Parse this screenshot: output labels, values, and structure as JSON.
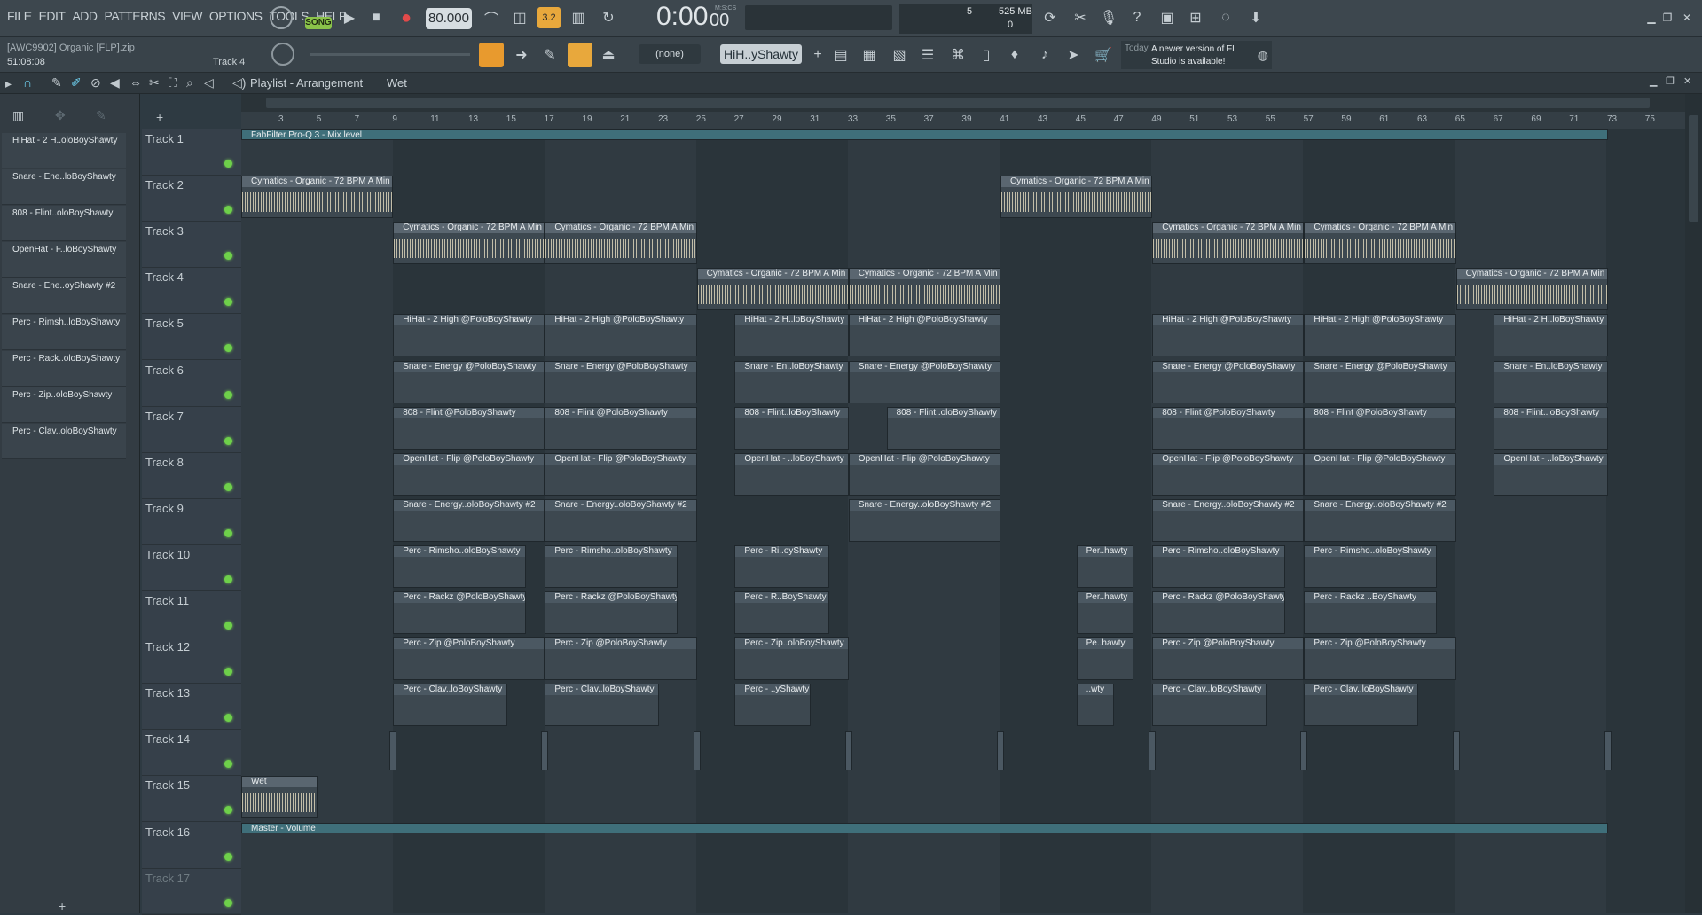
{
  "menu": {
    "items": [
      "FILE",
      "EDIT",
      "ADD",
      "PATTERNS",
      "VIEW",
      "OPTIONS",
      "TOOLS",
      "HELP"
    ]
  },
  "transport": {
    "mode": "SONG",
    "tempo": "80.000",
    "pattern_length": "3.2",
    "time": "0:00",
    "time_sub": "00",
    "time_unit": "M:S:CS"
  },
  "monitor": {
    "cpu_value": "5",
    "memory": "525 MB",
    "polyphony": "0"
  },
  "project": {
    "file": "[AWC9902] Organic [FLP].zip",
    "length": "51:08:08",
    "track_hint": "Track 4"
  },
  "snap": {
    "value": "(none)"
  },
  "pattern_selector": {
    "value": "HiH..yShawty"
  },
  "news": {
    "date": "Today",
    "message": "A newer version of FL Studio is available!"
  },
  "playlist": {
    "title": "Playlist - Arrangement",
    "crumb": "Wet"
  },
  "ruler": {
    "bars": [
      "3",
      "5",
      "7",
      "9",
      "11",
      "13",
      "15",
      "17",
      "19",
      "21",
      "23",
      "25",
      "27",
      "29",
      "31",
      "33",
      "35",
      "37",
      "39",
      "41",
      "43",
      "45",
      "47",
      "49",
      "51",
      "53",
      "55",
      "57",
      "59",
      "61",
      "63",
      "65",
      "67",
      "69",
      "71",
      "73",
      "75"
    ]
  },
  "picker": {
    "items": [
      "HiHat - 2 H..oloBoyShawty",
      "Snare - Ene..loBoyShawty",
      "808 - Flint..oloBoyShawty",
      "OpenHat - F..loBoyShawty",
      "Snare - Ene..oyShawty #2",
      "Perc - Rimsh..loBoyShawty",
      "Perc - Rack..oloBoyShawty",
      "Perc - Zip..oloBoyShawty",
      "Perc - Clav..oloBoyShawty"
    ]
  },
  "tracks": [
    "Track 1",
    "Track 2",
    "Track 3",
    "Track 4",
    "Track 5",
    "Track 6",
    "Track 7",
    "Track 8",
    "Track 9",
    "Track 10",
    "Track 11",
    "Track 12",
    "Track 13",
    "Track 14",
    "Track 15",
    "Track 16",
    "Track 17"
  ],
  "clips": {
    "t1": "FabFilter Pro-Q 3 - Mix level",
    "audio": "Cymatics - Organic - 72 BPM A Min",
    "hihat": "HiHat - 2 High @PoloBoyShawty",
    "hihat_s": "HiHat - 2 H..loBoyShawty",
    "snare": "Snare - Energy @PoloBoyShawty",
    "snare_s": "Snare - En..loBoyShawty",
    "flint": "808 - Flint @PoloBoyShawty",
    "flint_s": "808 - Flint..loBoyShawty",
    "flint_s2": "808 - Flint..oloBoyShawty",
    "openhat": "OpenHat - Flip @PoloBoyShawty",
    "openhat_s": "OpenHat - ..loBoyShawty",
    "snare2": "Snare - Energy..oloBoyShawty #2",
    "rimsh": "Perc - Rimsho..oloBoyShawty",
    "rimsh_s": "Perc - Ri..oyShawty",
    "rimsh_xs": "Per..hawty",
    "rackz": "Perc - Rackz @PoloBoyShawty",
    "rackz_s": "Perc - R..BoyShawty",
    "rackz_xs": "Per..hawty",
    "rackz_s2": "Perc - Rackz ..BoyShawty",
    "zip": "Perc - Zip @PoloBoyShawty",
    "zip_s": "Perc - Zip..oloBoyShawty",
    "zip_xs": "Pe..hawty",
    "clav": "Perc - Clav..loBoyShawty",
    "clav_s": "Perc - ..yShawty",
    "clav_xs": "..wty",
    "wet": "Wet",
    "master": "Master - Volume"
  }
}
